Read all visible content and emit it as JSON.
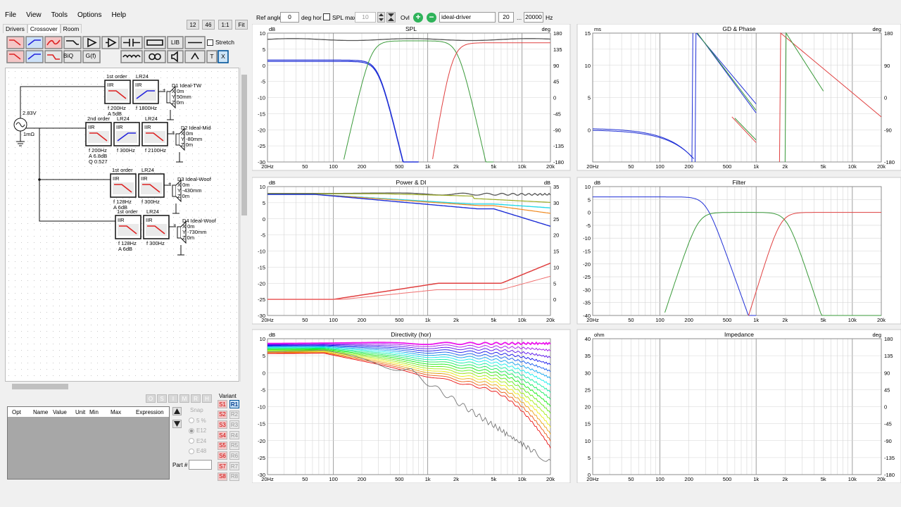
{
  "menu": [
    "File",
    "View",
    "Tools",
    "Options",
    "Help"
  ],
  "tabs": [
    "Drivers",
    "Crossover",
    "Room"
  ],
  "toolbar_left": {
    "lib": "LIB",
    "stretch": "Stretch",
    "biq": "BiQ",
    "gf": "G(f)",
    "t": "T",
    "x": "X"
  },
  "zoom_buttons": [
    "12",
    "46",
    "1:1",
    "Fit"
  ],
  "topbar": {
    "ref_angle_label": "Ref angle",
    "ref_angle": "0",
    "deg_hor": "deg hor",
    "spl_max_label": "SPL max",
    "spl_max": "10",
    "ovl": "Ovl",
    "driver": "ideal-driver",
    "f_from": "20",
    "ellipsis": "...",
    "f_to": "20000",
    "hz": "Hz"
  },
  "schematic": {
    "source_v": "2.83V",
    "source_r": "1mΩ",
    "blocks": [
      {
        "order": "1st order",
        "lr": "LR24",
        "iir1": "IIR",
        "iir2": "IIR",
        "p1": "f  200Hz",
        "p2": "A  5dB",
        "p3": "f  1800Hz",
        "drv": "D1 Ideal-TW",
        "x": "X 0m",
        "y": "Y 50mm",
        "z": "Z 0m"
      },
      {
        "order": "2nd order",
        "lr": "LR24",
        "lr2": "LR24",
        "iir1": "IIR",
        "iir2": "IIR",
        "iir3": "IIR",
        "p1": "f  200Hz",
        "p2": "A  6.8dB",
        "p3": "Q  0.527",
        "p4": "f  300Hz",
        "p5": "f  2100Hz",
        "drv": "D2 Ideal-Mid",
        "x": "X 0m",
        "y": "Y -80mm",
        "z": "Z 0m"
      },
      {
        "order": "1st order",
        "lr": "LR24",
        "iir1": "IIR",
        "iir2": "IIR",
        "p1": "f  128Hz",
        "p2": "A  6dB",
        "p3": "f  300Hz",
        "drv": "D3 Ideal-Woof",
        "x": "X 0m",
        "y": "Y -430mm",
        "z": "Z 0m"
      },
      {
        "order": "1st order",
        "lr": "LR24",
        "iir1": "IIR",
        "iir2": "IIR",
        "p1": "f  128Hz",
        "p2": "A  6dB",
        "p3": "f  300Hz",
        "drv": "D4 Ideal-Woof",
        "x": "X 0m",
        "y": "Y -730mm",
        "z": "Z 0m"
      }
    ]
  },
  "osimrh": [
    "O",
    "S",
    "I",
    "M",
    "R",
    "H"
  ],
  "param_table": {
    "cols": [
      "Opt",
      "Name",
      "Value",
      "Unit",
      "Min",
      "Max",
      "Expression"
    ]
  },
  "snap": {
    "label": "Snap",
    "options": [
      "5 %",
      "E12",
      "E24",
      "E48"
    ],
    "part": "Part #"
  },
  "variant": {
    "label": "Variant",
    "s": [
      "S1",
      "S2",
      "S3",
      "S4",
      "S5",
      "S6",
      "S7",
      "S8"
    ],
    "r": [
      "R1",
      "R2",
      "R3",
      "R4",
      "R5",
      "R6",
      "R7",
      "R8"
    ]
  },
  "x_ticks": [
    "20Hz",
    "50",
    "100",
    "200",
    "500",
    "1k",
    "2k",
    "5k",
    "10k",
    "20k"
  ],
  "plots": {
    "spl": {
      "title": "SPL",
      "lunit": "dB",
      "runit": "deg",
      "left": [
        "10",
        "5",
        "0",
        "-5",
        "-10",
        "-15",
        "-20",
        "-25",
        "-30"
      ],
      "right": [
        "180",
        "135",
        "90",
        "45",
        "0",
        "-45",
        "-90",
        "-135",
        "-180"
      ]
    },
    "gd": {
      "title": "GD & Phase",
      "lunit": "ms",
      "runit": "deg",
      "left": [
        "15",
        "",
        "10",
        "",
        "5",
        "",
        "0",
        "",
        ""
      ],
      "right": [
        "180",
        "",
        "90",
        "",
        "0",
        "",
        "-90",
        "",
        "-180"
      ]
    },
    "power": {
      "title": "Power & DI",
      "lunit": "dB",
      "runit": "dB",
      "left": [
        "10",
        "5",
        "0",
        "-5",
        "-10",
        "-15",
        "-20",
        "-25",
        "-30"
      ],
      "right": [
        "35",
        "30",
        "25",
        "20",
        "15",
        "10",
        "5",
        "0",
        ""
      ]
    },
    "filter": {
      "title": "Filter",
      "lunit": "dB",
      "runit": "",
      "left": [
        "10",
        "5",
        "0",
        "-5",
        "-10",
        "-15",
        "-20",
        "-25",
        "-30",
        "-35",
        "-40"
      ]
    },
    "dir": {
      "title": "Directivity (hor)",
      "lunit": "dB",
      "runit": "",
      "left": [
        "10",
        "5",
        "0",
        "-5",
        "-10",
        "-15",
        "-20",
        "-25",
        "-30"
      ]
    },
    "imp": {
      "title": "Impedance",
      "lunit": "ohm",
      "runit": "deg",
      "left": [
        "40",
        "35",
        "30",
        "25",
        "20",
        "15",
        "10",
        "5",
        "0"
      ],
      "right": [
        "180",
        "135",
        "90",
        "45",
        "0",
        "-45",
        "-90",
        "-135",
        "-180"
      ]
    }
  },
  "colors": {
    "blue": "#1f2fd6",
    "green": "#3a9a3a",
    "red": "#e04040",
    "grey": "#555555",
    "cyan": "#22d8e8",
    "orange": "#f08a20",
    "olive": "#99aa22",
    "magenta": "#ee22ee"
  }
}
